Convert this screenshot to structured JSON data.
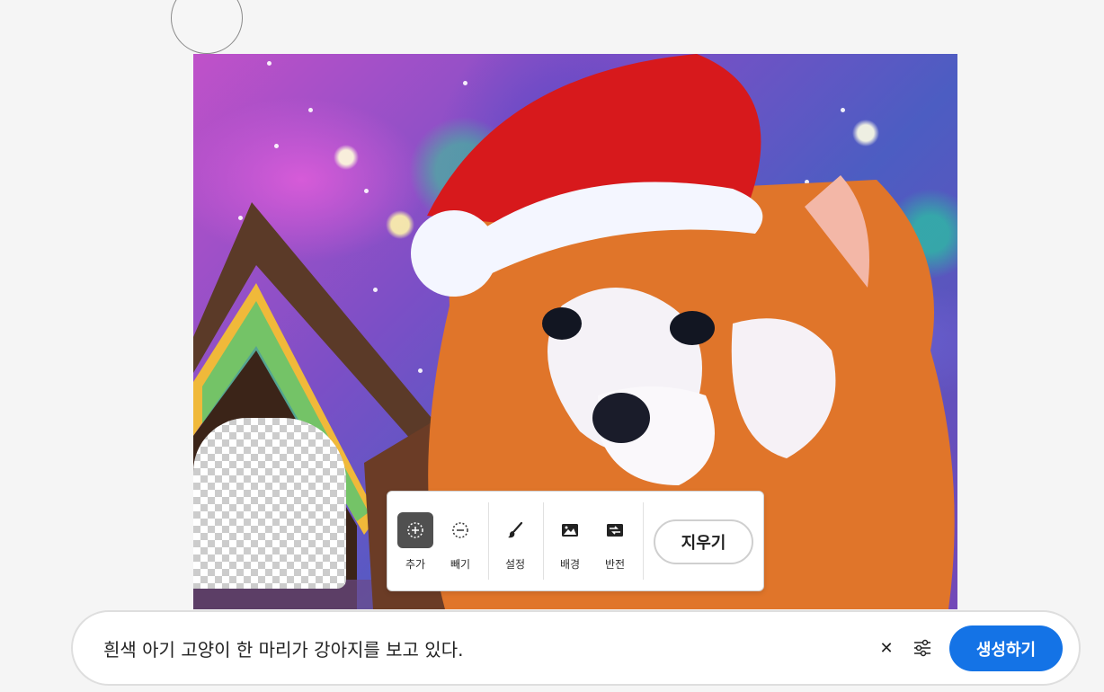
{
  "toolbar": {
    "tools": [
      {
        "label": "추가",
        "icon": "add-selection-icon",
        "active": true
      },
      {
        "label": "빼기",
        "icon": "subtract-selection-icon",
        "active": false
      },
      {
        "label": "설정",
        "icon": "brush-icon",
        "active": false
      },
      {
        "label": "배경",
        "icon": "image-background-icon",
        "active": false
      },
      {
        "label": "반전",
        "icon": "invert-icon",
        "active": false
      }
    ],
    "erase_label": "지우기"
  },
  "prompt": {
    "text": "흰색 아기 고양이 한 마리가 강아지를 보고 있다.",
    "clear_icon": "close-icon",
    "settings_icon": "sliders-icon",
    "generate_label": "생성하기"
  },
  "colors": {
    "accent": "#1473e6",
    "active_tool": "#505050"
  }
}
